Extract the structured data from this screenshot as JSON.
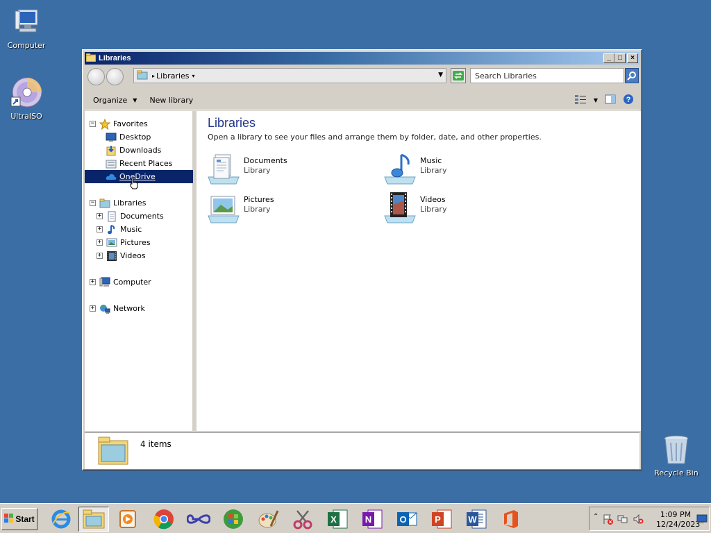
{
  "desktop": {
    "icons": [
      {
        "label": "Computer"
      },
      {
        "label": "UltraISO"
      },
      {
        "label": "Recycle Bin"
      }
    ]
  },
  "window": {
    "title": "Libraries",
    "controls": {
      "minimize": "_",
      "maximize": "□",
      "close": "×"
    },
    "address": {
      "crumb": "Libraries"
    },
    "search": {
      "placeholder": "Search Libraries"
    },
    "toolbar": {
      "organize": "Organize",
      "new_library": "New library"
    },
    "nav": {
      "favorites": {
        "label": "Favorites",
        "items": [
          "Desktop",
          "Downloads",
          "Recent Places",
          "OneDrive"
        ]
      },
      "libraries": {
        "label": "Libraries",
        "items": [
          "Documents",
          "Music",
          "Pictures",
          "Videos"
        ]
      },
      "computer": "Computer",
      "network": "Network",
      "selected": "OneDrive"
    },
    "content": {
      "heading": "Libraries",
      "description": "Open a library to see your files and arrange them by folder, date, and other properties.",
      "libraries": [
        {
          "name": "Documents",
          "kind": "Library",
          "icon": "documents-library-icon"
        },
        {
          "name": "Music",
          "kind": "Library",
          "icon": "music-library-icon"
        },
        {
          "name": "Pictures",
          "kind": "Library",
          "icon": "pictures-library-icon"
        },
        {
          "name": "Videos",
          "kind": "Library",
          "icon": "videos-library-icon"
        }
      ]
    },
    "details": {
      "count": "4 items"
    }
  },
  "taskbar": {
    "start": "Start",
    "apps": [
      "internet-explorer",
      "windows-explorer",
      "media-player",
      "chrome",
      "infinity-app",
      "windows-media-center",
      "paint",
      "snipping-tool",
      "excel",
      "onenote",
      "outlook",
      "powerpoint",
      "word",
      "office"
    ],
    "clock": {
      "time": "1:09 PM",
      "date": "12/24/2023"
    }
  }
}
